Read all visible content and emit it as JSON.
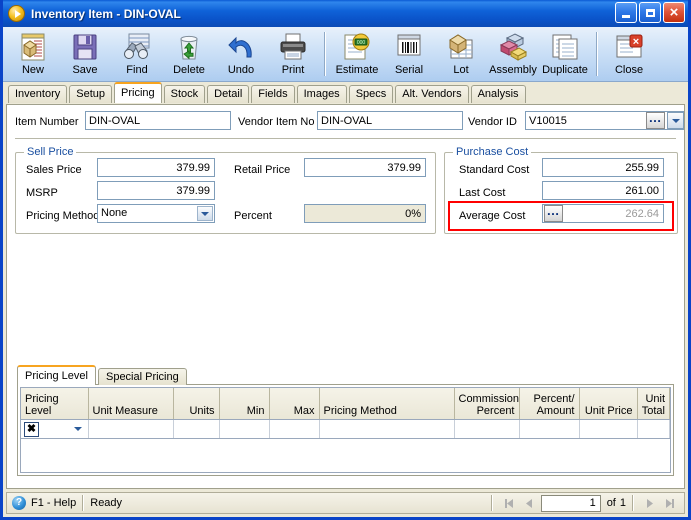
{
  "window": {
    "title_main": "Inventory Item",
    "title_sep": " - ",
    "title_item": "DIN-OVAL",
    "app_icon": "play-circle-icon",
    "buttons": {
      "minimize": "minimize-icon",
      "maximize": "maximize-icon",
      "close": "close-icon"
    }
  },
  "toolbar": {
    "items": [
      {
        "label": "New",
        "icon": "new-document-icon"
      },
      {
        "label": "Save",
        "icon": "floppy-disk-icon"
      },
      {
        "label": "Find",
        "icon": "binoculars-icon"
      },
      {
        "label": "Delete",
        "icon": "recycle-bin-icon"
      },
      {
        "label": "Undo",
        "icon": "undo-arrow-icon"
      },
      {
        "label": "Print",
        "icon": "printer-icon"
      },
      {
        "label": "Estimate",
        "icon": "estimate-money-icon"
      },
      {
        "label": "Serial",
        "icon": "barcode-icon"
      },
      {
        "label": "Lot",
        "icon": "lot-box-icon"
      },
      {
        "label": "Assembly",
        "icon": "assembly-blocks-icon"
      },
      {
        "label": "Duplicate",
        "icon": "duplicate-pages-icon"
      },
      {
        "label": "Close",
        "icon": "close-window-icon"
      }
    ]
  },
  "tabs": [
    {
      "label": "Inventory",
      "active": false
    },
    {
      "label": "Setup",
      "active": false
    },
    {
      "label": "Pricing",
      "active": true
    },
    {
      "label": "Stock",
      "active": false
    },
    {
      "label": "Detail",
      "active": false
    },
    {
      "label": "Fields",
      "active": false
    },
    {
      "label": "Images",
      "active": false
    },
    {
      "label": "Specs",
      "active": false
    },
    {
      "label": "Alt. Vendors",
      "active": false
    },
    {
      "label": "Analysis",
      "active": false
    }
  ],
  "header_fields": {
    "item_number_label": "Item Number",
    "item_number_value": "DIN-OVAL",
    "vendor_item_no_label": "Vendor Item No",
    "vendor_item_no_value": "DIN-OVAL",
    "vendor_id_label": "Vendor ID",
    "vendor_id_value": "V10015",
    "vendor_id_ellipsis": "•••"
  },
  "sell_price": {
    "group_title": "Sell Price",
    "sales_price_label": "Sales Price",
    "sales_price_value": "379.99",
    "retail_price_label": "Retail Price",
    "retail_price_value": "379.99",
    "msrp_label": "MSRP",
    "msrp_value": "379.99",
    "pricing_method_label": "Pricing Method",
    "pricing_method_value": "None",
    "pricing_method_options": [
      "None"
    ],
    "percent_label": "Percent",
    "percent_value": "0%"
  },
  "purchase_cost": {
    "group_title": "Purchase Cost",
    "standard_cost_label": "Standard Cost",
    "standard_cost_value": "255.99",
    "last_cost_label": "Last Cost",
    "last_cost_value": "261.00",
    "average_cost_label": "Average Cost",
    "average_cost_value": "262.64",
    "average_cost_ellipsis": "•••",
    "highlight_color": "#ff0000"
  },
  "inner_tabs": [
    {
      "label": "Pricing Level",
      "active": true
    },
    {
      "label": "Special Pricing",
      "active": false
    }
  ],
  "grid": {
    "columns": [
      {
        "header": "Pricing\nLevel",
        "align": "l"
      },
      {
        "header": "Unit Measure",
        "align": "l"
      },
      {
        "header": "Units",
        "align": "r"
      },
      {
        "header": "Min",
        "align": "r"
      },
      {
        "header": "Max",
        "align": "r"
      },
      {
        "header": "Pricing Method",
        "align": "l"
      },
      {
        "header": "Commission\nPercent",
        "align": "r"
      },
      {
        "header": "Percent/\nAmount",
        "align": "r"
      },
      {
        "header": "Unit Price",
        "align": "r"
      },
      {
        "header": "Unit Total",
        "align": "r"
      }
    ],
    "rows": [
      {
        "pricing_level": "",
        "unit_measure": "",
        "units": "",
        "min": "",
        "max": "",
        "pricing_method": "",
        "commission_percent": "",
        "percent_amount": "",
        "unit_price": "",
        "unit_total": ""
      }
    ],
    "row_marker": "✖"
  },
  "statusbar": {
    "help_icon": "help-question-icon",
    "help_label": "F1 - Help",
    "status_text": "Ready",
    "nav": {
      "first": "◀▏",
      "prev": "◀",
      "page_value": "1",
      "of_label": "of",
      "total_pages": "1",
      "next": "▶",
      "last": "▕▶"
    }
  }
}
